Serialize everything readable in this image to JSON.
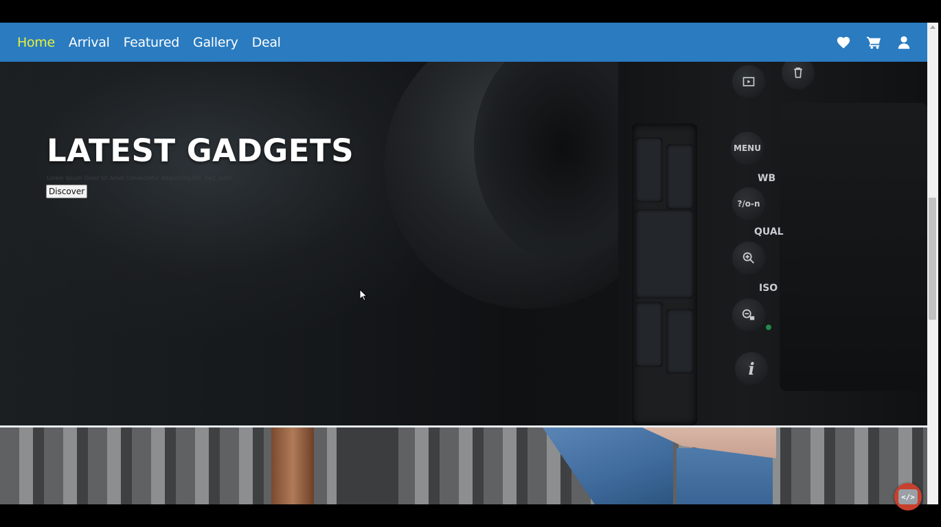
{
  "nav": {
    "links": [
      {
        "label": "Home",
        "active": true
      },
      {
        "label": "Arrival"
      },
      {
        "label": "Featured"
      },
      {
        "label": "Gallery"
      },
      {
        "label": "Deal"
      }
    ],
    "icons": [
      "heart-icon",
      "cart-icon",
      "user-icon"
    ]
  },
  "hero": {
    "title": "LATEST GADGETS",
    "subtitle": "Lorem Ipsum Dolor Sit Amet Consectetur Adipisicing Elit. Sed, Iusto",
    "button_label": "Discover",
    "camera_labels": {
      "menu": "MENU",
      "wb": "WB",
      "help": "?/o-n",
      "qual": "QUAL",
      "iso": "ISO",
      "info": "i"
    }
  },
  "fab": {
    "label": "</>"
  },
  "colors": {
    "navbar": "#2a7bc0",
    "active_link": "#e7f23a",
    "fab": "#c8402e"
  }
}
